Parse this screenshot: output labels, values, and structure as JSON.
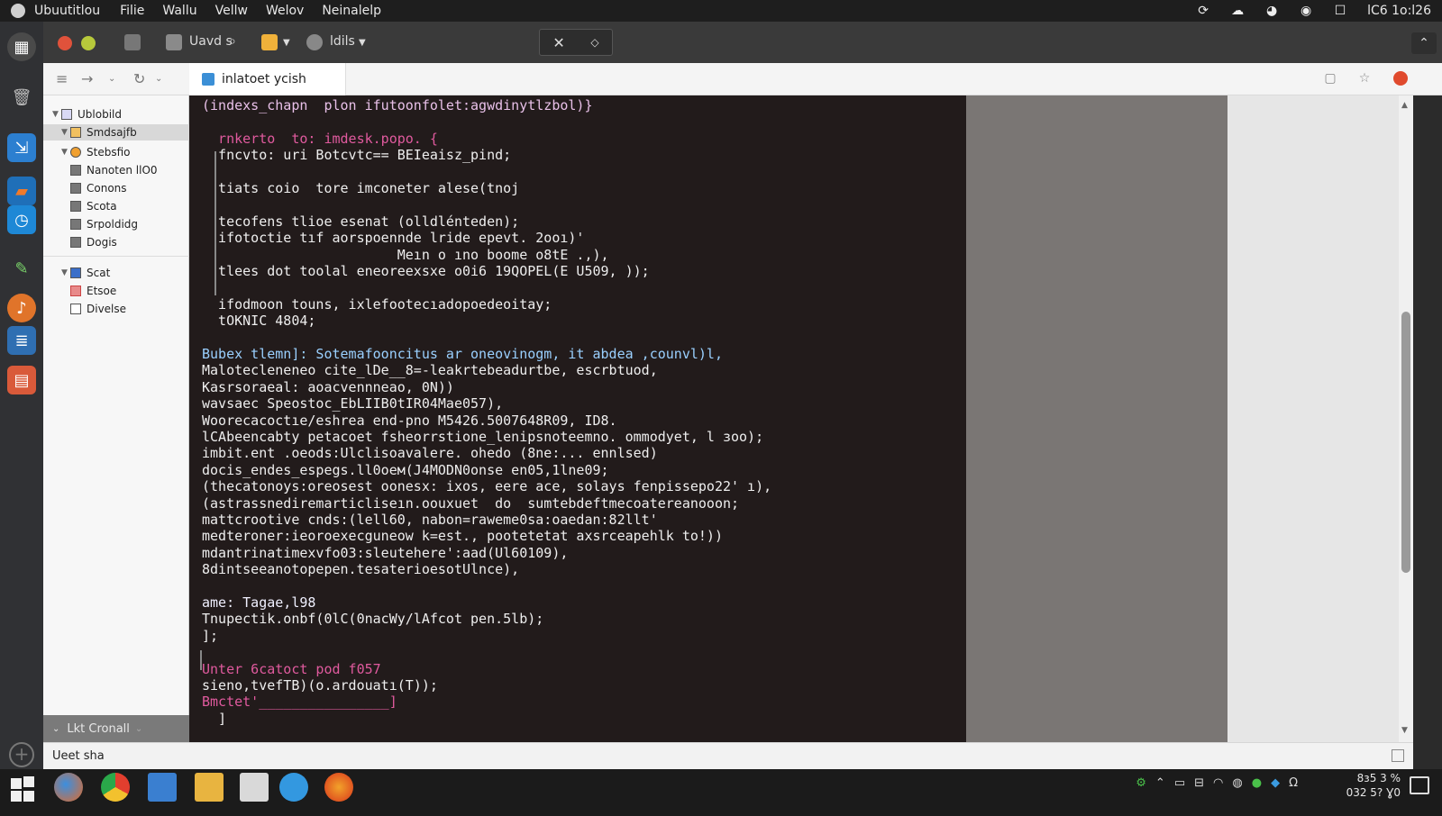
{
  "system_bar": {
    "app_name": "Ubuutitlou",
    "menu": [
      "Filie",
      "Wallu",
      "Vellw",
      "Welov",
      "Neinalelp"
    ],
    "clock": "lC6 1ᴏ:l26"
  },
  "window_toolbar": {
    "tool1_label": "Uavd s",
    "tool2_label": "ldils"
  },
  "nav": {
    "tab_title": "inlatoet ycish"
  },
  "tree": {
    "items": [
      {
        "label": "Ublobild",
        "level": 0,
        "arrow": "▼"
      },
      {
        "label": "Smdsajfb",
        "level": 1,
        "arrow": "▼",
        "selected": true
      },
      {
        "label": "Stebsfio",
        "level": 1,
        "arrow": "▼"
      },
      {
        "label": "Nanoten llO0",
        "level": 1,
        "arrow": ""
      },
      {
        "label": "Conons",
        "level": 1,
        "arrow": ""
      },
      {
        "label": "Scota",
        "level": 1,
        "arrow": ""
      },
      {
        "label": "Srpoldidg",
        "level": 1,
        "arrow": ""
      },
      {
        "label": "Dogis",
        "level": 1,
        "arrow": ""
      },
      {
        "label": "Scat",
        "level": 0,
        "arrow": "▼"
      },
      {
        "label": "Etsoe",
        "level": 1,
        "arrow": ""
      },
      {
        "label": "Divelse",
        "level": 1,
        "arrow": ""
      }
    ],
    "footer_label": "Lkt Cronall"
  },
  "editor": {
    "lines": [
      "(indexs_chapn  plon ifutoonfolet:agwdinytlzbol)}",
      "",
      "  rnkerto  to: imdesk.popo. {",
      "  fncvto: uri Botcvtc== BEIeaisz_pind;",
      "",
      "  tiats coio  tore imconeter alese(tnoj",
      "",
      "  tecofens tlioe esenat (olldlénteden);",
      "  ifotoctie tıf aorspoennde lride epevt. 2ooı)'",
      "                        Meın o ıno boome o8tE .,),",
      "  tlees dot toolal eneoreexsxe o0i6 19QOPEL(E U509, ));",
      "",
      "  ifodmoon touns, ixlefootecıadopoedeoitay;",
      "  tOKNIC 4804;",
      "",
      "Bubex tlemn]: Sotemafooncitus ar oneovinogm, it abdea ,counvl)l,",
      "Malotecleneneo cite_lDe__8=-leakrtebeadurtbe, escrbtuod,",
      "Kasrsoraeal: aoacvennneao, 0N))",
      "wavsaec Speostoc_EbLIIB0tIR04Mae057),",
      "Woorecacoctıe/eshrea end-pno M5426.5007648R09, ID8.",
      "lCAbeencabty petacoet fsheorrstione_lenipsnoteemno. ommodyet, l ɜoo);",
      "imbit.ent .oeods:Ulclisoavalere. ohedo (8ne:... ennlsed)",
      "docis_endes_espegs.ll0oeм(J4MODN0onse en05,1lne09;",
      "(thecatonoys:oreosest oonesx: ixos, eere ace, solays fenpissepo22' ı),",
      "(astrassnediremarticliseın.oouxuet  do  sumtebdeftmecoatereanooon;",
      "mattcrootive cnds:(lell60, nabon=raweme0sa:oaedan:82llt'",
      "medteroner:ieoroexecguneow k=est., pootetetat axsrceapehlk to!))",
      "mdantrinatimexvfo03:sleutehere':aad(Ul60109),",
      "8dintseeanotopepen.tesaterioesotUlnce),",
      "",
      "ame: Tagae,l98",
      "Tnupectik.onbf(0lC(0nacWy/lAfcot pen.5lb);",
      "];",
      "",
      "Unter 6catoct pod f057",
      "sieno,tvefTB)(o.ardouatı(T));",
      "Bmctet'________________]",
      "  ]"
    ]
  },
  "status_bar": {
    "text": "Ueet sha"
  },
  "taskbar": {
    "clock_line1": "8ɜ5 3 %",
    "clock_line2": "032 5? Ɣ0"
  },
  "colors": {
    "editor_bg": "#221b1b",
    "keyword_pink": "#e05a9e",
    "keyword_blue": "#7ab8f5",
    "keyword_green": "#5fbf4f"
  }
}
